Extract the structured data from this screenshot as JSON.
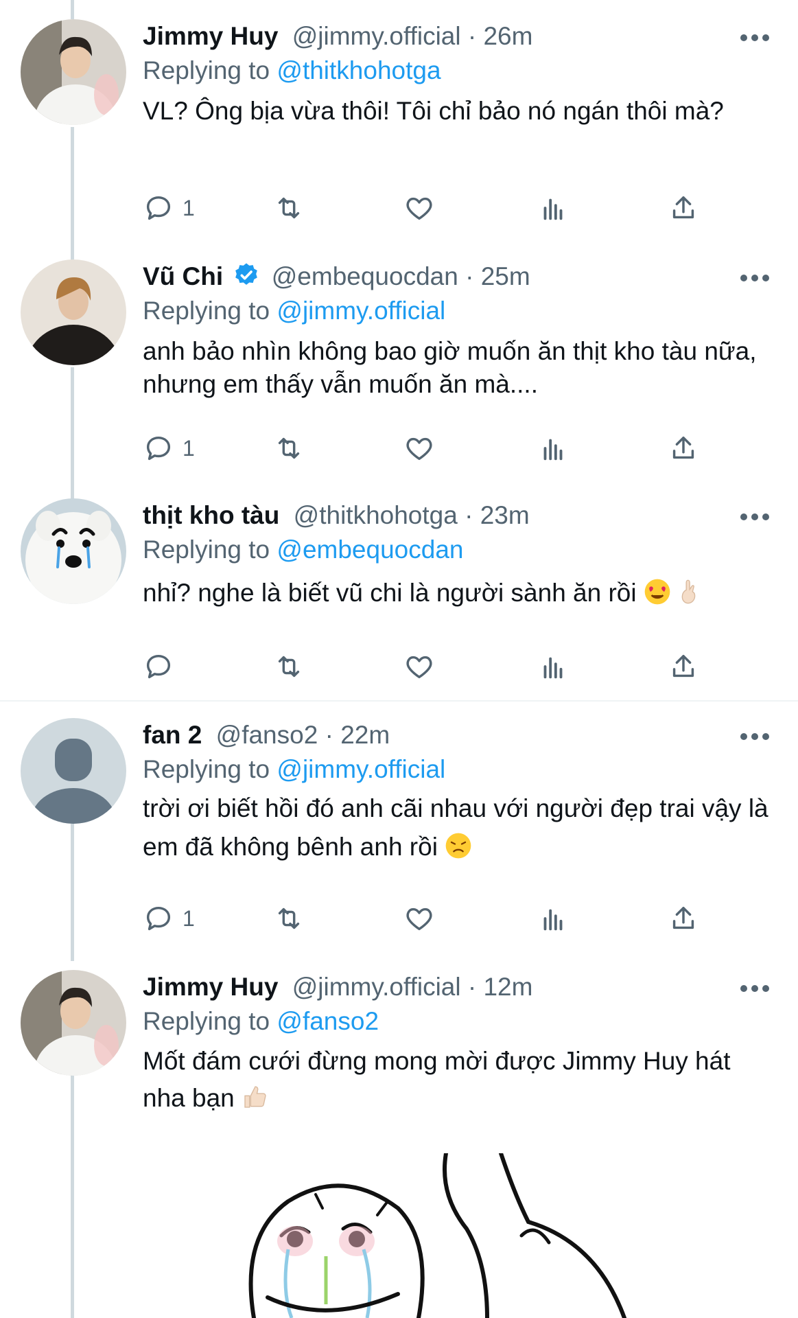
{
  "tweets": [
    {
      "name": "Jimmy Huy",
      "handle": "@jimmy.official",
      "time": "26m",
      "replying_label": "Replying to",
      "replying_to": "@thitkhohotga",
      "text": "VL? Ông bịa vừa thôi! Tôi chỉ bảo nó ngán thôi mà?",
      "reply_count": "1",
      "verified": false,
      "avatar": "avatar-jimmy"
    },
    {
      "name": "Vũ Chi",
      "handle": "@embequocdan",
      "time": "25m",
      "replying_label": "Replying to",
      "replying_to": "@jimmy.official",
      "text": "anh bảo nhìn không bao giờ muốn ăn thịt kho tàu nữa, nhưng em thấy vẫn muốn ăn mà....",
      "reply_count": "1",
      "verified": true,
      "avatar": "avatar-vuchi"
    },
    {
      "name": "thịt kho tàu",
      "handle": "@thitkhohotga",
      "time": "23m",
      "replying_label": "Replying to",
      "replying_to": "@embequocdan",
      "text": "nhỉ? nghe là biết vũ chi là người sành ăn rồi",
      "reply_count": "",
      "verified": false,
      "avatar": "avatar-dog",
      "emojis": [
        "heart-eyes-emoji",
        "ok-hand-emoji"
      ]
    },
    {
      "name": "fan 2",
      "handle": "@fanso2",
      "time": "22m",
      "replying_label": "Replying to",
      "replying_to": "@jimmy.official",
      "text": "trời ơi biết hồi đó anh cãi nhau với người đẹp trai vậy là em đã không bênh anh rồi",
      "reply_count": "1",
      "verified": false,
      "avatar": "avatar-default",
      "emojis": [
        "tired-face-emoji"
      ]
    },
    {
      "name": "Jimmy Huy",
      "handle": "@jimmy.official",
      "time": "12m",
      "replying_label": "Replying to",
      "replying_to": "@fanso2",
      "text": "Mốt đám cưới đừng mong mời được Jimmy Huy hát nha bạn",
      "reply_count": "",
      "verified": false,
      "avatar": "avatar-jimmy",
      "emojis": [
        "thumbs-up-emoji"
      ]
    }
  ],
  "separator": "·",
  "icons": {
    "reply": "reply-icon",
    "retweet": "retweet-icon",
    "like": "like-icon",
    "analytics": "analytics-icon",
    "share": "share-icon",
    "more": "more-icon"
  },
  "colors": {
    "accent": "#1d9bf0",
    "secondary_text": "#536471",
    "thread_line": "#cfd9de"
  }
}
